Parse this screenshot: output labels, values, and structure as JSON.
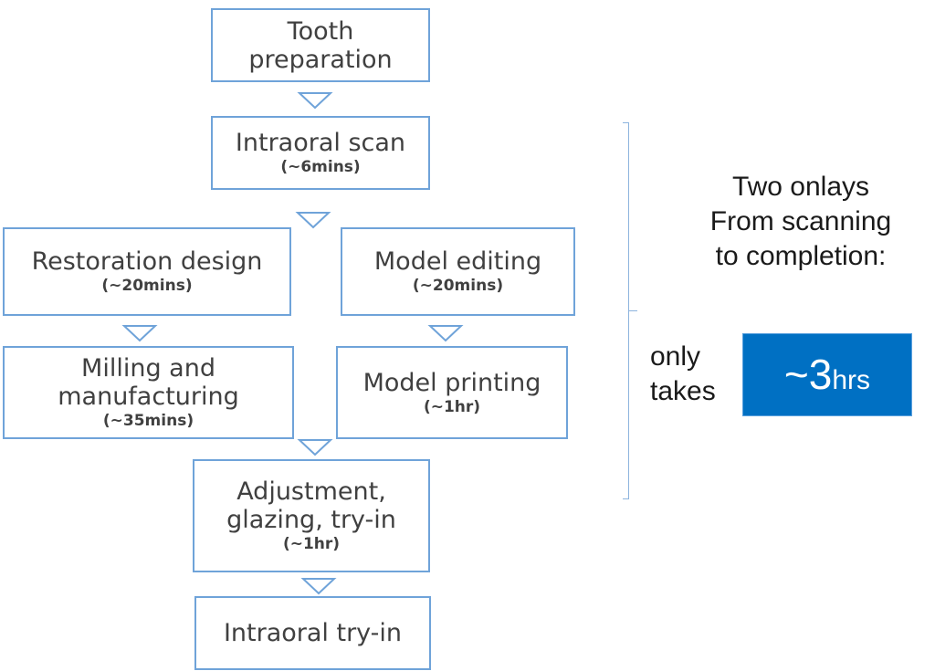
{
  "flow": {
    "steps": [
      {
        "id": "tooth-preparation",
        "title": "Tooth\npreparation",
        "title_lines": [
          "Tooth",
          "preparation"
        ],
        "duration": ""
      },
      {
        "id": "intraoral-scan",
        "title_lines": [
          "Intraoral scan"
        ],
        "duration": "(~6mins)"
      },
      {
        "id": "restoration-design",
        "title_lines": [
          "Restoration design"
        ],
        "duration": "(~20mins)"
      },
      {
        "id": "model-editing",
        "title_lines": [
          "Model editing"
        ],
        "duration": "(~20mins)"
      },
      {
        "id": "milling-manufacturing",
        "title_lines": [
          "Milling and",
          "manufacturing"
        ],
        "duration": "(~35mins)"
      },
      {
        "id": "model-printing",
        "title_lines": [
          "Model printing"
        ],
        "duration": "(~1hr)"
      },
      {
        "id": "adjustment",
        "title_lines": [
          "Adjustment,",
          "glazing, try-in"
        ],
        "duration": "(~1hr)"
      },
      {
        "id": "intraoral-try-in",
        "title_lines": [
          "Intraoral try-in"
        ],
        "duration": ""
      }
    ],
    "edges": [
      [
        "tooth-preparation",
        "intraoral-scan"
      ],
      [
        "intraoral-scan",
        "restoration-design"
      ],
      [
        "intraoral-scan",
        "model-editing"
      ],
      [
        "restoration-design",
        "milling-manufacturing"
      ],
      [
        "model-editing",
        "model-printing"
      ],
      [
        "milling-manufacturing",
        "adjustment"
      ],
      [
        "model-printing",
        "adjustment"
      ],
      [
        "adjustment",
        "intraoral-try-in"
      ]
    ]
  },
  "summary": {
    "lines": [
      "Two onlays",
      "From scanning",
      "to completion:"
    ],
    "only_takes": [
      "only",
      "takes"
    ],
    "total_value": "~3",
    "total_unit": "hrs"
  },
  "colors": {
    "box_border": "#6fa3d9",
    "badge_fill": "#0070c3",
    "text": "#404040"
  }
}
